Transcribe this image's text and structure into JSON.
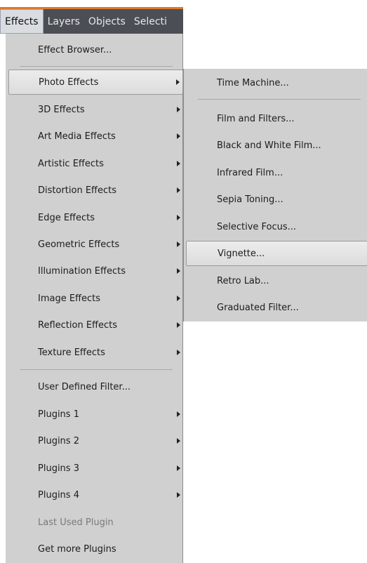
{
  "menubar": {
    "items": [
      {
        "label": "Effects"
      },
      {
        "label": "Layers"
      },
      {
        "label": "Objects"
      },
      {
        "label": "Selecti"
      }
    ]
  },
  "effects_menu": {
    "items": [
      {
        "label": "Effect Browser..."
      },
      {
        "label": "Photo Effects"
      },
      {
        "label": "3D Effects"
      },
      {
        "label": "Art Media Effects"
      },
      {
        "label": "Artistic Effects"
      },
      {
        "label": "Distortion Effects"
      },
      {
        "label": "Edge Effects"
      },
      {
        "label": "Geometric Effects"
      },
      {
        "label": "Illumination Effects"
      },
      {
        "label": "Image Effects"
      },
      {
        "label": "Reflection Effects"
      },
      {
        "label": "Texture Effects"
      },
      {
        "label": "User Defined Filter..."
      },
      {
        "label": "Plugins 1"
      },
      {
        "label": "Plugins 2"
      },
      {
        "label": "Plugins 3"
      },
      {
        "label": "Plugins 4"
      },
      {
        "label": "Last Used Plugin"
      },
      {
        "label": "Get more Plugins"
      }
    ]
  },
  "photo_effects_submenu": {
    "items": [
      {
        "label": "Time Machine..."
      },
      {
        "label": "Film and Filters..."
      },
      {
        "label": "Black and White Film..."
      },
      {
        "label": "Infrared Film..."
      },
      {
        "label": "Sepia Toning..."
      },
      {
        "label": "Selective Focus..."
      },
      {
        "label": "Vignette..."
      },
      {
        "label": "Retro Lab..."
      },
      {
        "label": "Graduated Filter..."
      }
    ]
  },
  "colors": {
    "menubar_bg": "#4b4f55",
    "menubar_accent": "#e07a2c",
    "menu_bg": "#d0d0d0",
    "highlight_bg": "#e6e6e6"
  }
}
